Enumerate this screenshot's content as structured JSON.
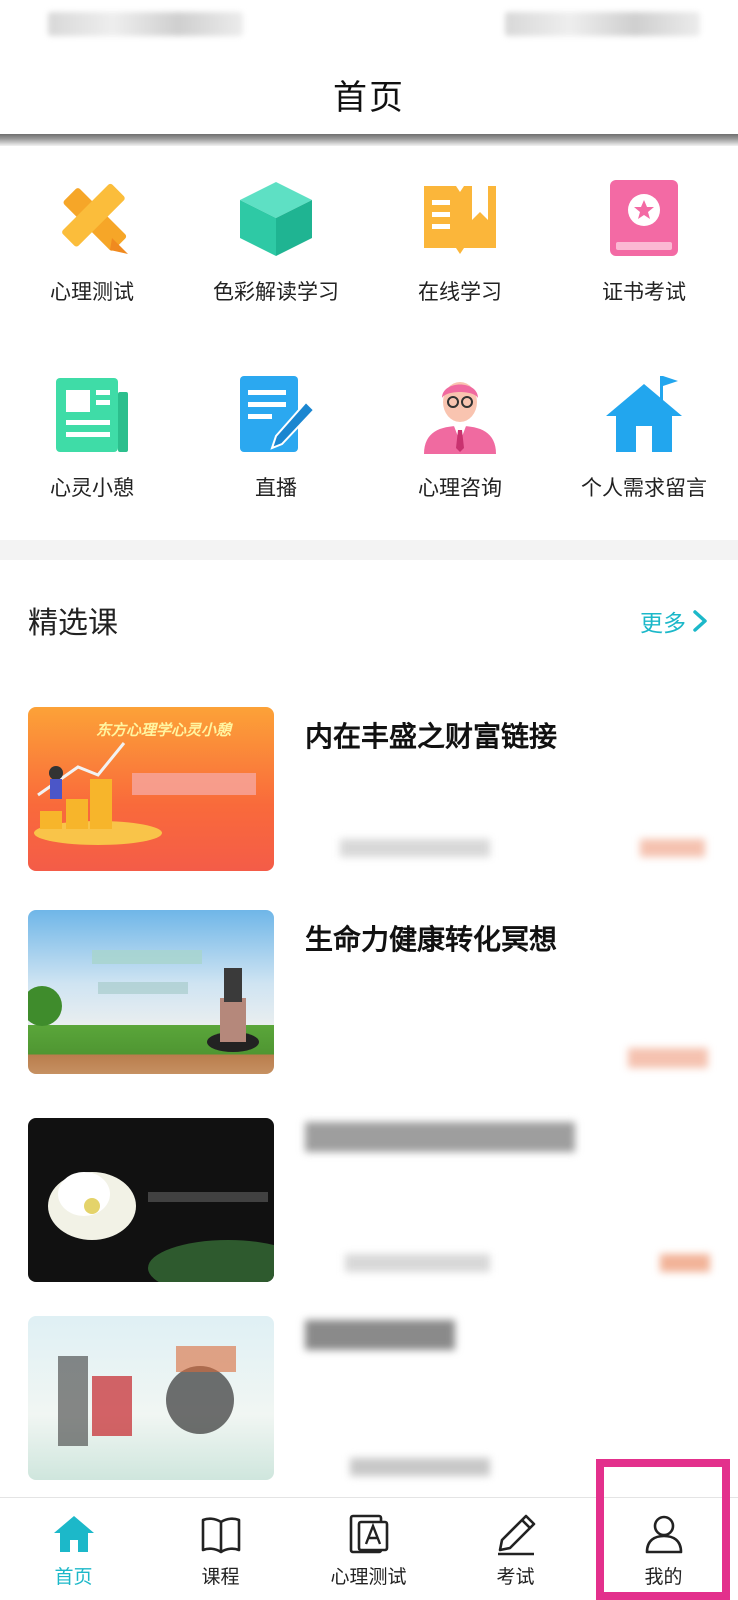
{
  "header": {
    "title": "首页"
  },
  "grid": {
    "items": [
      {
        "label": "心理测试",
        "icon": "ruler-pencil-icon"
      },
      {
        "label": "色彩解读学习",
        "icon": "cube-icon"
      },
      {
        "label": "在线学习",
        "icon": "open-book-icon"
      },
      {
        "label": "证书考试",
        "icon": "certificate-icon"
      },
      {
        "label": "心灵小憩",
        "icon": "newspaper-icon"
      },
      {
        "label": "直播",
        "icon": "document-pen-icon"
      },
      {
        "label": "心理咨询",
        "icon": "counselor-icon"
      },
      {
        "label": "个人需求留言",
        "icon": "house-flag-icon"
      }
    ]
  },
  "featured": {
    "title": "精选课",
    "more_label": "更多",
    "courses": [
      {
        "title": "内在丰盛之财富链接"
      },
      {
        "title": "生命力健康转化冥想"
      }
    ],
    "thumb1_caption": "东方心理学心灵小憩"
  },
  "tabbar": {
    "tabs": [
      {
        "label": "首页",
        "icon": "home-icon"
      },
      {
        "label": "课程",
        "icon": "book-icon"
      },
      {
        "label": "心理测试",
        "icon": "test-icon"
      },
      {
        "label": "考试",
        "icon": "pen-icon"
      },
      {
        "label": "我的",
        "icon": "user-icon"
      }
    ]
  },
  "colors": {
    "accent": "#1cb8c9",
    "highlight": "#e3308c"
  }
}
